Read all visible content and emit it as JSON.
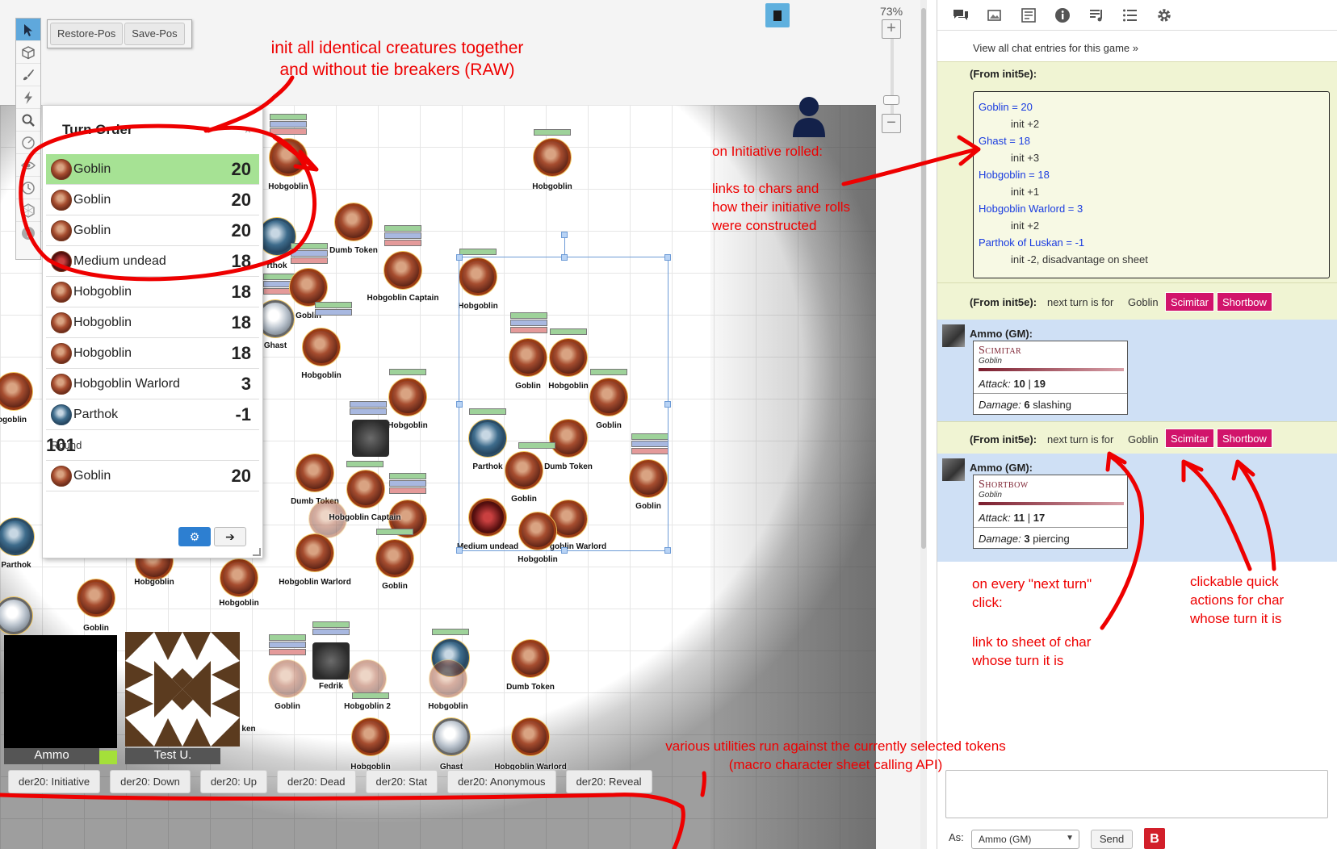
{
  "toolbar": {
    "icons": [
      "select-icon",
      "cube-icon",
      "brush-icon",
      "lightning-icon",
      "magnifier-icon",
      "ruler-icon",
      "eye-icon",
      "clock-icon",
      "dice-icon",
      "help-icon"
    ]
  },
  "position_buttons": {
    "restore": "Restore-Pos",
    "save": "Save-Pos"
  },
  "zoom": {
    "level": "73%"
  },
  "turn_order": {
    "title": "Turn Order",
    "close": "×",
    "rows": [
      {
        "name": "Goblin",
        "value": "20",
        "icon": "goblin",
        "active": true
      },
      {
        "name": "Goblin",
        "value": "20",
        "icon": "goblin"
      },
      {
        "name": "Goblin",
        "value": "20",
        "icon": "goblin"
      },
      {
        "name": "Medium undead",
        "value": "18",
        "icon": "undead"
      },
      {
        "name": "Hobgoblin",
        "value": "18",
        "icon": "goblin"
      },
      {
        "name": "Hobgoblin",
        "value": "18",
        "icon": "goblin"
      },
      {
        "name": "Hobgoblin",
        "value": "18",
        "icon": "goblin"
      },
      {
        "name": "Hobgoblin Warlord",
        "value": "3",
        "icon": "goblin"
      },
      {
        "name": "Parthok",
        "value": "-1",
        "icon": "blue"
      },
      {
        "name": "Round",
        "value": "101",
        "icon": "none"
      },
      {
        "name": "Goblin",
        "value": "20",
        "icon": "goblin"
      }
    ]
  },
  "tokens": {
    "hobgoblin": "Hobgoblin",
    "dumb_token": "Dumb Token",
    "hobgoblin_captain": "Hobgoblin Captain",
    "parthok": "Parthok",
    "ghast": "Ghast",
    "goblin": "Goblin",
    "medium_undead": "Medium undead",
    "hobgoblin_warlord": "Hobgoblin Warlord",
    "fedrik": "Fedrik",
    "hobgoblin_2": "Hobgoblin 2",
    "goblin_warlord_partial": "goblin Warlord",
    "rthok": "rthok",
    "ogoblin": "ogoblin",
    "obgoblin_captain": "Hobgoblin Captain",
    "ken": "ken"
  },
  "portraits": {
    "ammo": "Ammo",
    "test": "Test U."
  },
  "macros": [
    "der20: Initiative",
    "der20: Down",
    "der20: Up",
    "der20: Dead",
    "der20: Stat",
    "der20: Anonymous",
    "der20: Reveal"
  ],
  "annotations": {
    "init_all": "init all identical creatures together\nand without tie breakers (RAW)",
    "on_init": "on Initiative rolled:",
    "links": "links to chars and\nhow their initiative rolls\nwere constructed",
    "utilities": "various utilities run against the currently selected tokens\n(macro character sheet calling API)",
    "next_turn": "on every \"next turn\"\nclick:",
    "link_sheet": "link to sheet of char\nwhose turn it is",
    "quick_actions": "clickable quick\nactions for char\nwhose turn it is"
  },
  "chat": {
    "tabs": [
      "chat-bubble-icon",
      "images-icon",
      "journal-icon",
      "info-icon",
      "music-icon",
      "list-icon",
      "settings-icon"
    ],
    "view_all": "View all chat entries for this game »",
    "msg1": {
      "from": "(From init5e):",
      "lines": [
        {
          "link": "Goblin = 20",
          "detail": "init +2"
        },
        {
          "link": "Ghast = 18",
          "detail": "init +3"
        },
        {
          "link": "Hobgoblin = 18",
          "detail": "init +1"
        },
        {
          "link": "Hobgoblin Warlord = 3",
          "detail": "init +2"
        },
        {
          "link": "Parthok of Luskan = -1",
          "detail": "init -2, disadvantage on sheet"
        }
      ]
    },
    "msg2": {
      "from": "(From init5e):",
      "text": "next turn is for",
      "who": "Goblin",
      "btn1": "Scimitar",
      "btn2": "Shortbow"
    },
    "msg3": {
      "from": "Ammo (GM):",
      "title": "Scimitar",
      "sub": "Goblin",
      "attack_label": "Attack:",
      "attack1": "10",
      "sep": "|",
      "attack2": "19",
      "damage_label": "Damage:",
      "damage_val": "6",
      "damage_type": "slashing"
    },
    "msg4": {
      "from": "(From init5e):",
      "text": "next turn is for",
      "who": "Goblin",
      "btn1": "Scimitar",
      "btn2": "Shortbow"
    },
    "msg5": {
      "from": "Ammo (GM):",
      "title": "Shortbow",
      "sub": "Goblin",
      "attack_label": "Attack:",
      "attack1": "11",
      "sep": "|",
      "attack2": "17",
      "damage_label": "Damage:",
      "damage_val": "3",
      "damage_type": "piercing"
    },
    "as_label": "As:",
    "as_value": "Ammo (GM)",
    "send": "Send",
    "logo": "B"
  }
}
